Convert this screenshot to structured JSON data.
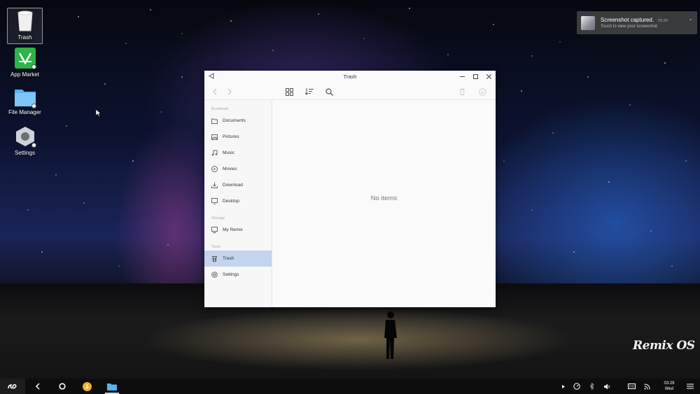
{
  "desktop": {
    "icons": [
      {
        "label": "Trash",
        "icon": "trash-icon"
      },
      {
        "label": "App Market",
        "icon": "app-market-icon"
      },
      {
        "label": "File Manager",
        "icon": "folder-icon"
      },
      {
        "label": "Settings",
        "icon": "settings-hex-icon"
      }
    ],
    "brand": "Remix OS"
  },
  "notification": {
    "title": "Screenshot captured.",
    "time": "03:29",
    "text": "Touch to view your screenshot."
  },
  "window": {
    "title": "Trash",
    "sidebar": {
      "sections": {
        "bookmark": "Bookmark",
        "storage": "Storage",
        "tools": "Tools"
      },
      "bookmarks": [
        "Documents",
        "Pictures",
        "Music",
        "Movies",
        "Download",
        "Desktop"
      ],
      "storage_items": [
        "My Remix"
      ],
      "tool_items": [
        "Trash",
        "Settings"
      ],
      "active_item": "Trash"
    },
    "content": {
      "empty_text": "No items"
    }
  },
  "taskbar": {
    "clock_time": "03:29",
    "clock_day": "Wed"
  },
  "colors": {
    "selection": "#c3d4ec",
    "taskbar": "#0d0d0d",
    "notification_bg": "#3a3b3d"
  }
}
